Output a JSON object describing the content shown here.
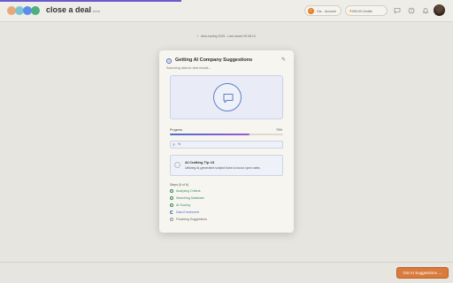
{
  "app": {
    "brand": "close a deal",
    "brand_suffix": "beta",
    "logo_colors": [
      "#e8a87c",
      "#7ec4cf",
      "#5b8def",
      "#4caf7d"
    ]
  },
  "topbar": {
    "user_initial": "C",
    "user_label": "Cla... Account",
    "credits_label": "993.00 Credits",
    "icons": [
      "chat-icon",
      "help-icon",
      "bell-icon"
    ]
  },
  "autosave": {
    "text": "Auto-saving 2026 - Last saved 09:38:10"
  },
  "footer": {
    "suggest_button": "Get AI Suggestions →"
  },
  "modal": {
    "title": "Getting AI Company Suggestions",
    "subtitle": "Searching data for best results...",
    "progress_label": "Progress",
    "progress_value_text": "70%",
    "progress_fraction": 0.7,
    "status_text": "% ",
    "tip_title": "AI Crafting Tip #3",
    "tip_text": "Utilizing AI-generated subject lines to boost open rates.",
    "steps_label": "Steps (5 of 6)",
    "steps": [
      {
        "label": "Analyzing Criteria",
        "state": "done"
      },
      {
        "label": "Searching Database",
        "state": "done"
      },
      {
        "label": "AI Scoring",
        "state": "done"
      },
      {
        "label": "Data Enrichment",
        "state": "active"
      },
      {
        "label": "Finalizing Suggestions",
        "state": "pending"
      }
    ]
  }
}
